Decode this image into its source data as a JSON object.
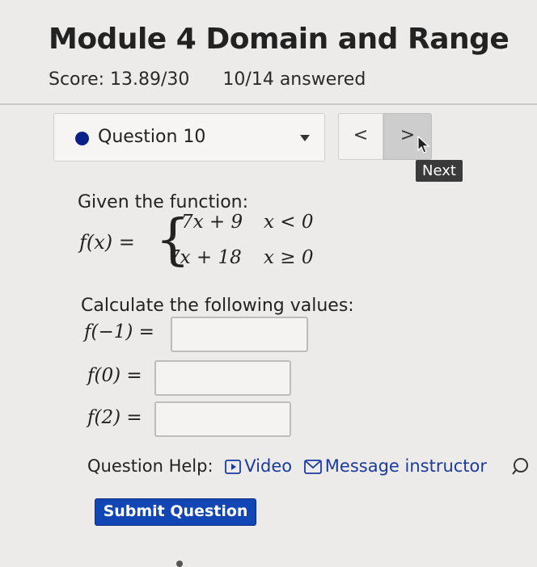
{
  "header": {
    "title": "Module 4 Domain and Range",
    "score": "Score: 13.89/30",
    "answered": "10/14 answered"
  },
  "question_nav": {
    "current": "Question 10",
    "prev_label": "<",
    "next_label": ">",
    "next_tooltip": "Next"
  },
  "problem": {
    "intro": "Given the function:",
    "fx": "f(x) =",
    "case1_expr": "7x + 9",
    "case1_cond": "x < 0",
    "case2_expr": "7x + 18",
    "case2_cond": "x ≥ 0",
    "prompt": "Calculate the following values:",
    "rows": [
      {
        "label": "f(−1) =",
        "value": ""
      },
      {
        "label": "f(0) =",
        "value": ""
      },
      {
        "label": "f(2) =",
        "value": ""
      }
    ]
  },
  "help": {
    "label": "Question Help:",
    "video": "Video",
    "message": "Message instructor"
  },
  "submit_label": "Submit Question",
  "colors": {
    "accent": "#1246b4",
    "question_dot": "#0b1f8a",
    "link": "#1a3aa0"
  }
}
